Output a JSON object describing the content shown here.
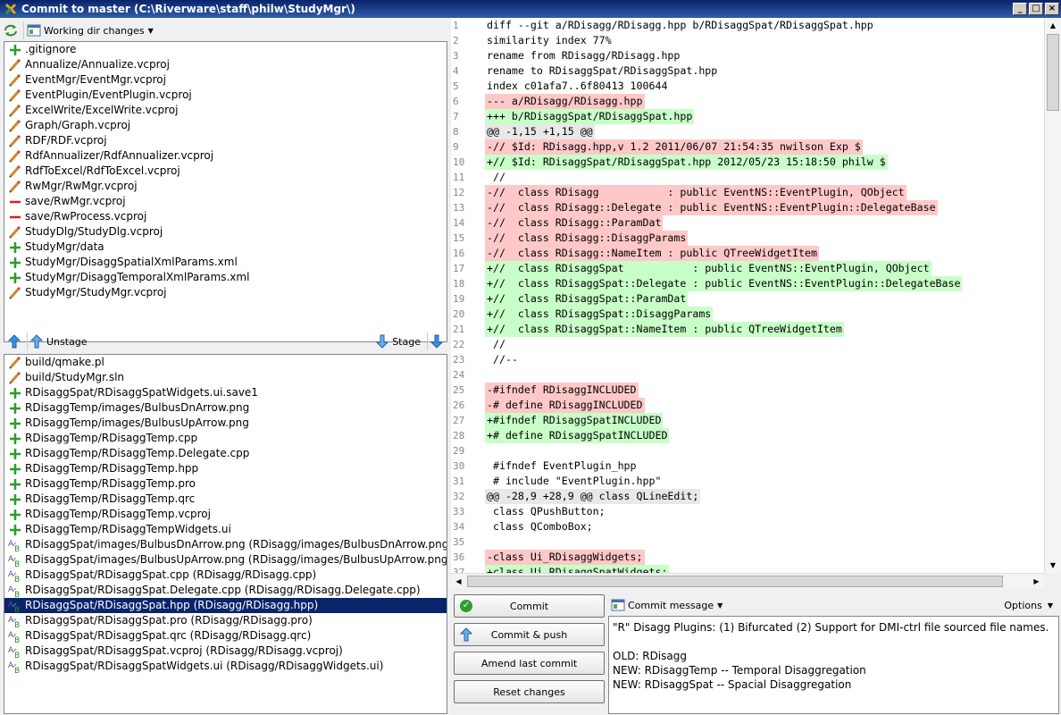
{
  "window": {
    "title": "Commit to master (C:\\Riverware\\staff\\philw\\StudyMgr\\)"
  },
  "unstaged": {
    "dropdown_label": "Working dir changes",
    "files": [
      {
        "icon": "added",
        "name": ".gitignore"
      },
      {
        "icon": "modified",
        "name": "Annualize/Annualize.vcproj"
      },
      {
        "icon": "modified",
        "name": "EventMgr/EventMgr.vcproj"
      },
      {
        "icon": "modified",
        "name": "EventPlugin/EventPlugin.vcproj"
      },
      {
        "icon": "modified",
        "name": "ExcelWrite/ExcelWrite.vcproj"
      },
      {
        "icon": "modified",
        "name": "Graph/Graph.vcproj"
      },
      {
        "icon": "modified",
        "name": "RDF/RDF.vcproj"
      },
      {
        "icon": "modified",
        "name": "RdfAnnualizer/RdfAnnualizer.vcproj"
      },
      {
        "icon": "modified",
        "name": "RdfToExcel/RdfToExcel.vcproj"
      },
      {
        "icon": "modified",
        "name": "RwMgr/RwMgr.vcproj"
      },
      {
        "icon": "deleted",
        "name": "save/RwMgr.vcproj"
      },
      {
        "icon": "deleted",
        "name": "save/RwProcess.vcproj"
      },
      {
        "icon": "modified",
        "name": "StudyDlg/StudyDlg.vcproj"
      },
      {
        "icon": "added",
        "name": "StudyMgr/data"
      },
      {
        "icon": "added",
        "name": "StudyMgr/DisaggSpatialXmlParams.xml"
      },
      {
        "icon": "added",
        "name": "StudyMgr/DisaggTemporalXmlParams.xml"
      },
      {
        "icon": "modified",
        "name": "StudyMgr/StudyMgr.vcproj"
      }
    ]
  },
  "stage_bar": {
    "unstage_label": "Unstage",
    "stage_label": "Stage"
  },
  "staged": {
    "files": [
      {
        "icon": "modified",
        "name": "build/qmake.pl"
      },
      {
        "icon": "modified",
        "name": "build/StudyMgr.sln"
      },
      {
        "icon": "added",
        "name": "RDisaggSpat/RDisaggSpatWidgets.ui.save1"
      },
      {
        "icon": "added",
        "name": "RDisaggTemp/images/BulbusDnArrow.png"
      },
      {
        "icon": "added",
        "name": "RDisaggTemp/images/BulbusUpArrow.png"
      },
      {
        "icon": "added",
        "name": "RDisaggTemp/RDisaggTemp.cpp"
      },
      {
        "icon": "added",
        "name": "RDisaggTemp/RDisaggTemp.Delegate.cpp"
      },
      {
        "icon": "added",
        "name": "RDisaggTemp/RDisaggTemp.hpp"
      },
      {
        "icon": "added",
        "name": "RDisaggTemp/RDisaggTemp.pro"
      },
      {
        "icon": "added",
        "name": "RDisaggTemp/RDisaggTemp.qrc"
      },
      {
        "icon": "added",
        "name": "RDisaggTemp/RDisaggTemp.vcproj"
      },
      {
        "icon": "added",
        "name": "RDisaggTemp/RDisaggTempWidgets.ui"
      },
      {
        "icon": "renamed",
        "name": "RDisaggSpat/images/BulbusDnArrow.png (RDisagg/images/BulbusDnArrow.png)"
      },
      {
        "icon": "renamed",
        "name": "RDisaggSpat/images/BulbusUpArrow.png (RDisagg/images/BulbusUpArrow.png)"
      },
      {
        "icon": "renamed",
        "name": "RDisaggSpat/RDisaggSpat.cpp (RDisagg/RDisagg.cpp)"
      },
      {
        "icon": "renamed",
        "name": "RDisaggSpat/RDisaggSpat.Delegate.cpp (RDisagg/RDisagg.Delegate.cpp)"
      },
      {
        "icon": "renamed",
        "name": "RDisaggSpat/RDisaggSpat.hpp (RDisagg/RDisagg.hpp)",
        "selected": true
      },
      {
        "icon": "renamed",
        "name": "RDisaggSpat/RDisaggSpat.pro (RDisagg/RDisagg.pro)"
      },
      {
        "icon": "renamed",
        "name": "RDisaggSpat/RDisaggSpat.qrc (RDisagg/RDisagg.qrc)"
      },
      {
        "icon": "renamed",
        "name": "RDisaggSpat/RDisaggSpat.vcproj (RDisagg/RDisagg.vcproj)"
      },
      {
        "icon": "renamed",
        "name": "RDisaggSpat/RDisaggSpatWidgets.ui (RDisagg/RDisaggWidgets.ui)"
      }
    ]
  },
  "diff": {
    "lines": [
      {
        "n": "1",
        "t": "ctx",
        "text": "diff --git a/RDisagg/RDisagg.hpp b/RDisaggSpat/RDisaggSpat.hpp"
      },
      {
        "n": "2",
        "t": "ctx",
        "text": "similarity index 77%"
      },
      {
        "n": "3",
        "t": "ctx",
        "text": "rename from RDisagg/RDisagg.hpp"
      },
      {
        "n": "4",
        "t": "ctx",
        "text": "rename to RDisaggSpat/RDisaggSpat.hpp"
      },
      {
        "n": "5",
        "t": "ctx",
        "text": "index c01afa7..6f80413 100644"
      },
      {
        "n": "6",
        "t": "del",
        "text": "--- a/RDisagg/RDisagg.hpp"
      },
      {
        "n": "7",
        "t": "add",
        "text": "+++ b/RDisaggSpat/RDisaggSpat.hpp"
      },
      {
        "n": "8",
        "t": "hunk",
        "text": "@@ -1,15 +1,15 @@"
      },
      {
        "n": "9",
        "t": "del",
        "text": "-// $Id: RDisagg.hpp,v 1.2 2011/06/07 21:54:35 nwilson Exp $"
      },
      {
        "n": "10",
        "t": "add",
        "text": "+// $Id: RDisaggSpat/RDisaggSpat.hpp 2012/05/23 15:18:50 philw $"
      },
      {
        "n": "11",
        "t": "ctx",
        "text": " //"
      },
      {
        "n": "12",
        "t": "del",
        "text": "-//  class RDisagg           : public EventNS::EventPlugin, QObject"
      },
      {
        "n": "13",
        "t": "del",
        "text": "-//  class RDisagg::Delegate : public EventNS::EventPlugin::DelegateBase"
      },
      {
        "n": "14",
        "t": "del",
        "text": "-//  class RDisagg::ParamDat"
      },
      {
        "n": "15",
        "t": "del",
        "text": "-//  class RDisagg::DisaggParams"
      },
      {
        "n": "16",
        "t": "del",
        "text": "-//  class RDisagg::NameItem : public QTreeWidgetItem"
      },
      {
        "n": "17",
        "t": "add",
        "text": "+//  class RDisaggSpat           : public EventNS::EventPlugin, QObject"
      },
      {
        "n": "18",
        "t": "add",
        "text": "+//  class RDisaggSpat::Delegate : public EventNS::EventPlugin::DelegateBase"
      },
      {
        "n": "19",
        "t": "add",
        "text": "+//  class RDisaggSpat::ParamDat"
      },
      {
        "n": "20",
        "t": "add",
        "text": "+//  class RDisaggSpat::DisaggParams"
      },
      {
        "n": "21",
        "t": "add",
        "text": "+//  class RDisaggSpat::NameItem : public QTreeWidgetItem"
      },
      {
        "n": "22",
        "t": "ctx",
        "text": " //"
      },
      {
        "n": "23",
        "t": "ctx",
        "text": " //--"
      },
      {
        "n": "24",
        "t": "ctx",
        "text": ""
      },
      {
        "n": "25",
        "t": "del",
        "text": "-#ifndef RDisaggINCLUDED"
      },
      {
        "n": "26",
        "t": "del",
        "text": "-# define RDisaggINCLUDED"
      },
      {
        "n": "27",
        "t": "add",
        "text": "+#ifndef RDisaggSpatINCLUDED"
      },
      {
        "n": "28",
        "t": "add",
        "text": "+# define RDisaggSpatINCLUDED"
      },
      {
        "n": "29",
        "t": "ctx",
        "text": ""
      },
      {
        "n": "30",
        "t": "ctx",
        "text": " #ifndef EventPlugin_hpp"
      },
      {
        "n": "31",
        "t": "ctx",
        "text": " # include \"EventPlugin.hpp\""
      },
      {
        "n": "32",
        "t": "hunk",
        "text": "@@ -28,9 +28,9 @@ class QLineEdit;"
      },
      {
        "n": "33",
        "t": "ctx",
        "text": " class QPushButton;"
      },
      {
        "n": "34",
        "t": "ctx",
        "text": " class QComboBox;"
      },
      {
        "n": "35",
        "t": "ctx",
        "text": ""
      },
      {
        "n": "36",
        "t": "del",
        "text": "-class Ui_RDisaggWidgets;"
      },
      {
        "n": "37",
        "t": "add",
        "text": "+class Ui_RDisaggSpatWidgets;"
      }
    ]
  },
  "buttons": {
    "commit": "Commit",
    "commit_push": "Commit & push",
    "amend": "Amend last commit",
    "reset": "Reset changes"
  },
  "commit_message": {
    "dropdown_label": "Commit message",
    "options_label": "Options",
    "lines": [
      "\"R\" Disagg Plugins: (1) Bifurcated (2) Support for DMI-ctrl file sourced file names.",
      "",
      "OLD: RDisagg",
      "NEW: RDisaggTemp  -- Temporal Disaggregation",
      "NEW: RDisaggSpat -- Spacial Disaggregation"
    ]
  },
  "colors": {
    "added": "#c8ffc8",
    "deleted": "#ffc8c8",
    "hunk": "#e8e8e8",
    "selection": "#0a246a"
  }
}
